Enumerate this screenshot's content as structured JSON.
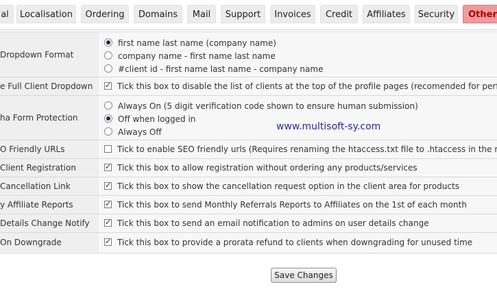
{
  "tabs": [
    {
      "label": "al"
    },
    {
      "label": "Localisation"
    },
    {
      "label": "Ordering"
    },
    {
      "label": "Domains"
    },
    {
      "label": "Mail"
    },
    {
      "label": "Support"
    },
    {
      "label": "Invoices"
    },
    {
      "label": "Credit"
    },
    {
      "label": "Affiliates"
    },
    {
      "label": "Security"
    },
    {
      "label": "Other",
      "active": true
    }
  ],
  "rows": [
    {
      "label": "Dropdown Format",
      "options": [
        {
          "text": "first name last name (company name)",
          "checked": true
        },
        {
          "text": "company name - first name last name",
          "checked": false
        },
        {
          "text": "#client id - first name last name - company name",
          "checked": false
        }
      ]
    },
    {
      "label": "e Full Client Dropdown",
      "checkbox": {
        "checked": true,
        "text": "Tick this box to disable the list of clients at the top of the profile pages (recomended for perform"
      }
    },
    {
      "label": "ha Form Protection",
      "options": [
        {
          "text": "Always On (5 digit verification code shown to ensure human submission)",
          "checked": false
        },
        {
          "text": "Off when logged in",
          "checked": true
        },
        {
          "text": "Always Off",
          "checked": false
        }
      ]
    },
    {
      "label": "O Friendly URLs",
      "checkbox": {
        "checked": false,
        "text": "Tick to enable SEO friendly urls (Requires renaming the htaccess.txt file to .htaccess in the root d"
      }
    },
    {
      "label": "Client Registration",
      "checkbox": {
        "checked": true,
        "text": "Tick this box to allow registration without ordering any products/services"
      }
    },
    {
      "label": "Cancellation Link",
      "checkbox": {
        "checked": true,
        "text": "Tick this box to show the cancellation request option in the client area for products"
      }
    },
    {
      "label": "y Affiliate Reports",
      "checkbox": {
        "checked": true,
        "text": "Tick this box to send Monthly Referrals Reports to Affiliates on the 1st of each month"
      }
    },
    {
      "label": "Details Change Notify",
      "checkbox": {
        "checked": true,
        "text": "Tick this box to send an email notification to admins on user details change"
      }
    },
    {
      "label": "On Downgrade",
      "checkbox": {
        "checked": true,
        "text": "Tick this box to provide a prorata refund to clients when downgrading for unused time"
      }
    }
  ],
  "watermark": "www.multisoft-sy.com",
  "save_label": "Save Changes"
}
